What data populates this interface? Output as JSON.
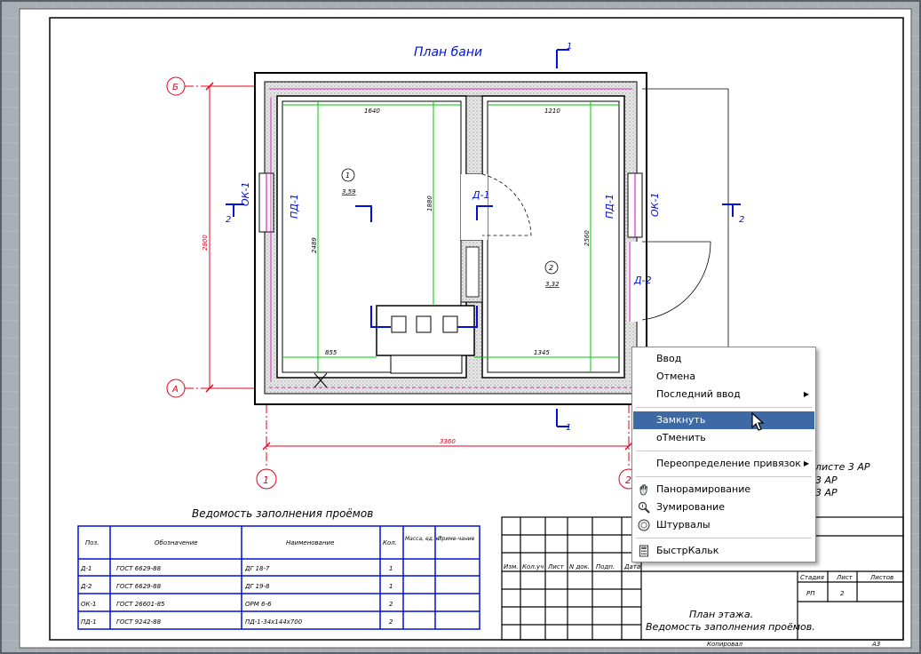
{
  "drawing": {
    "title": "План бани",
    "room1": {
      "number": "1",
      "area": "3,59"
    },
    "room2": {
      "number": "2",
      "area": "3,32"
    },
    "axes": {
      "b": "Б",
      "a": "А",
      "one": "1",
      "two": "2"
    },
    "dims": {
      "d1640": "1640",
      "d1210": "1210",
      "d2800": "2800",
      "d2489": "2489",
      "d1880": "1880",
      "d2560": "2560",
      "d855": "855",
      "d1345": "1345",
      "d3360": "3360"
    },
    "labels": {
      "ok1_left": "ОК-1",
      "ok1_right": "ОК-1",
      "pd1_left": "ПД-1",
      "pd1_right": "ПД-1",
      "d1": "Д-1",
      "d2": "Д-2",
      "sec1_top": "1",
      "sec1_bottom": "1",
      "sec2_left": "2",
      "sec2_right": "2"
    },
    "sheet_refs": [
      "листе 3 АР",
      "3 АР",
      "3 АР"
    ]
  },
  "schedule": {
    "title": "Ведомость заполнения проёмов",
    "headers": [
      "Поз.",
      "Обозначение",
      "Наименование",
      "Кол.",
      "Масса, ед. кг",
      "Приме-чание"
    ],
    "rows": [
      [
        "Д-1",
        "ГОСТ 6629-88",
        "ДГ 18-7",
        "1",
        "",
        ""
      ],
      [
        "Д-2",
        "ГОСТ 6629-88",
        "ДГ 19-8",
        "1",
        "",
        ""
      ],
      [
        "ОК-1",
        "ГОСТ 26601-85",
        "ОРМ 6-6",
        "2",
        "",
        ""
      ],
      [
        "ПД-1",
        "ГОСТ 9242-88",
        "ПД-1-34х144х700",
        "2",
        "",
        ""
      ]
    ]
  },
  "titleblock": {
    "cols": [
      "Изм.",
      "Кол.уч",
      "Лист",
      "N док.",
      "Подп.",
      "Дата"
    ],
    "stage_header": "Стадия",
    "sheet_header": "Лист",
    "sheets_header": "Листов",
    "stage": "РП",
    "sheet": "2",
    "name_line1": "План этажа.",
    "name_line2": "Ведомость заполнения проёмов.",
    "copied": "Копировал",
    "format": "А3"
  },
  "context_menu": {
    "items": [
      {
        "label": "Ввод",
        "type": "item"
      },
      {
        "label": "Отмена",
        "type": "item"
      },
      {
        "label": "Последний ввод",
        "type": "submenu"
      },
      {
        "type": "separator"
      },
      {
        "label": "Замкнуть",
        "type": "item",
        "highlighted": true
      },
      {
        "label": "оТменить",
        "type": "item"
      },
      {
        "type": "separator"
      },
      {
        "label": "Переопределение привязок",
        "type": "submenu"
      },
      {
        "type": "separator"
      },
      {
        "label": "Панорамирование",
        "type": "item",
        "icon": "pan-hand-icon"
      },
      {
        "label": "Зумирование",
        "type": "item",
        "icon": "zoom-magnifier-icon"
      },
      {
        "label": "Штурвалы",
        "type": "item",
        "icon": "steering-wheel-icon"
      },
      {
        "type": "separator"
      },
      {
        "label": "БыстрКальк",
        "type": "item",
        "icon": "calculator-icon"
      }
    ]
  },
  "colors": {
    "bg": "#a8aeb4",
    "grid": "#b8bec4",
    "paper": "#ffffff",
    "red": "#e0001a",
    "blue": "#0010d8",
    "green": "#00c800",
    "magenta": "#d000b8",
    "highlight": "#3d6aa4"
  }
}
